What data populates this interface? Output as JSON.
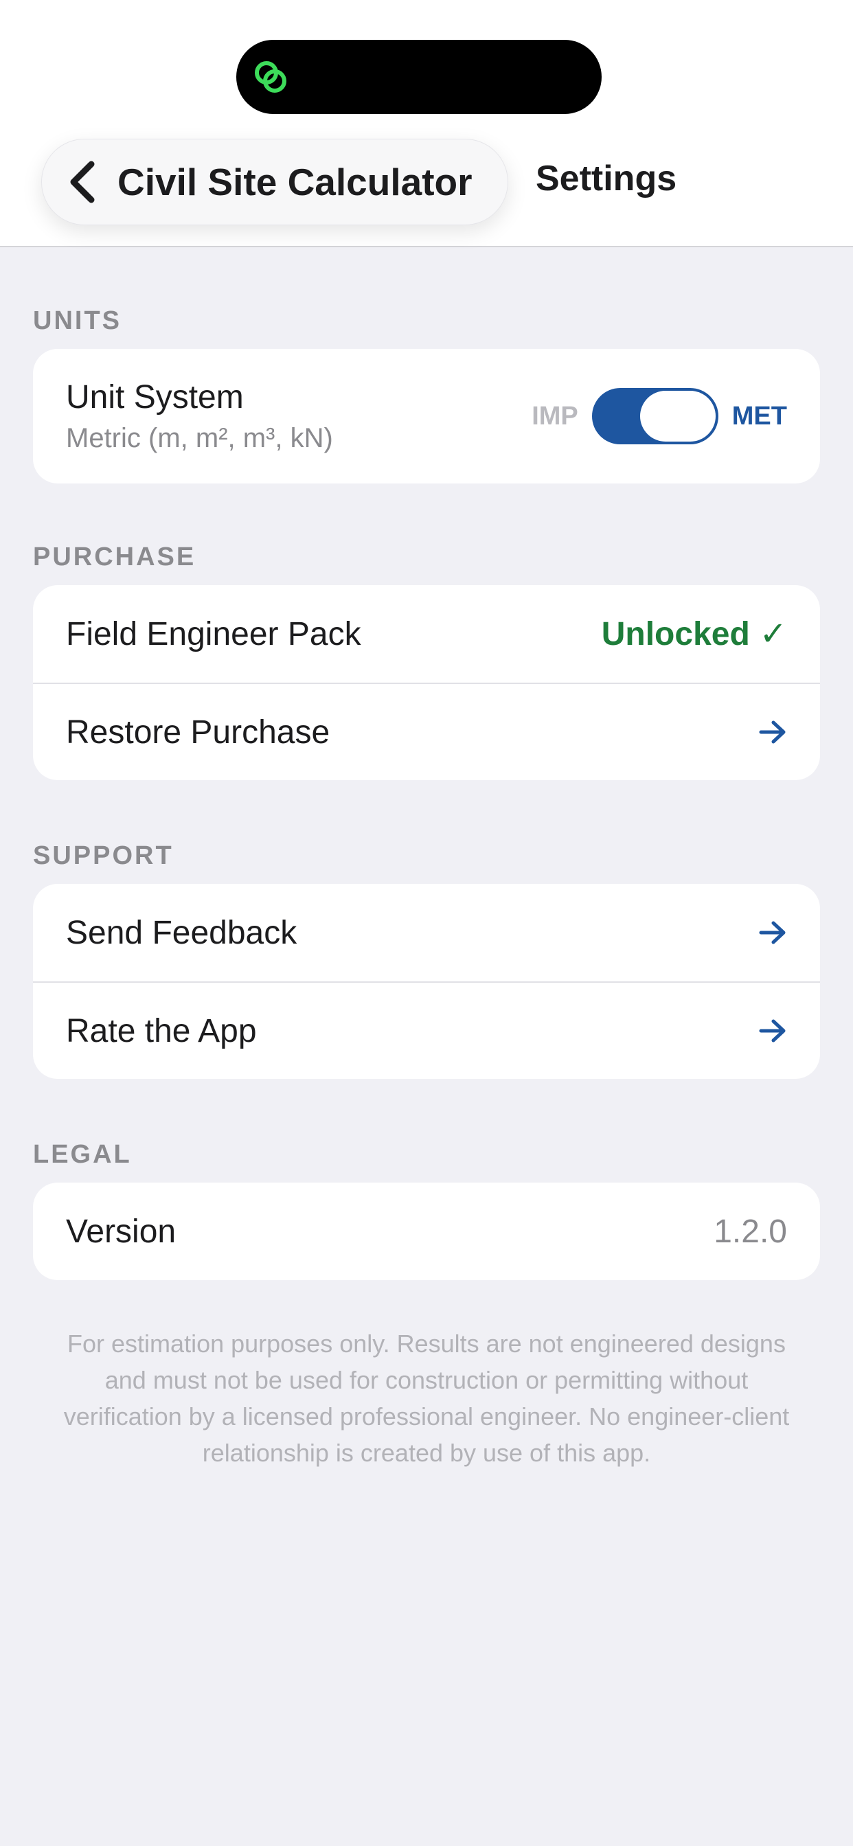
{
  "nav": {
    "back_title": "Civil Site Calculator",
    "title": "Settings"
  },
  "sections": {
    "units": {
      "header": "UNITS",
      "unit_system_label": "Unit System",
      "unit_system_value": "Metric (m, m², m³, kN)",
      "toggle_left": "IMP",
      "toggle_right": "MET",
      "toggle_on": true
    },
    "purchase": {
      "header": "PURCHASE",
      "pack_label": "Field Engineer Pack",
      "pack_status": "Unlocked",
      "pack_status_mark": "✓",
      "restore_label": "Restore Purchase"
    },
    "support": {
      "header": "SUPPORT",
      "feedback_label": "Send Feedback",
      "rate_label": "Rate the App"
    },
    "legal": {
      "header": "LEGAL",
      "version_label": "Version",
      "version_value": "1.2.0"
    }
  },
  "disclaimer": "For estimation purposes only. Results are not engineered designs and must not be used for construction or permitting without verification by a licensed professional engineer. No engineer-client relationship is created by use of this app.",
  "icons": {
    "island": "link-icon",
    "back": "chevron-left-icon",
    "row_arrow": "arrow-right-icon",
    "check": "checkmark-icon"
  },
  "colors": {
    "accent": "#1e56a0",
    "success": "#1e7d3a",
    "island_icon": "#3ddc5a",
    "background": "#f0f0f5"
  }
}
